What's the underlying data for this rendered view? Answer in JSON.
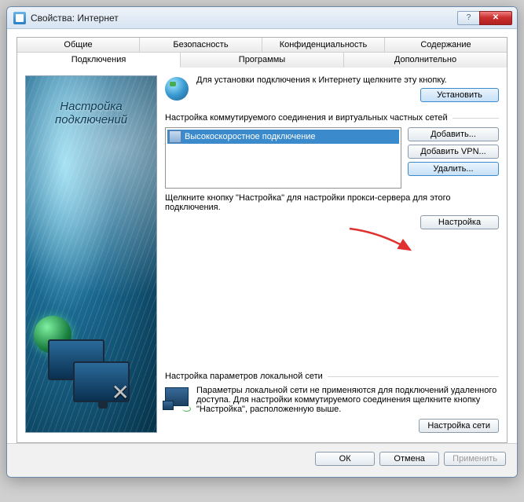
{
  "titlebar": {
    "title": "Свойства: Интернет"
  },
  "tabs": {
    "row1": [
      "Общие",
      "Безопасность",
      "Конфиденциальность",
      "Содержание"
    ],
    "row2": [
      "Подключения",
      "Программы",
      "Дополнительно"
    ],
    "active": "Подключения"
  },
  "side": {
    "line1": "Настройка",
    "line2": "подключений"
  },
  "setup": {
    "text": "Для установки подключения к Интернету щелкните эту кнопку.",
    "button": "Установить"
  },
  "dial": {
    "label": "Настройка коммутируемого соединения и виртуальных частных сетей",
    "item": "Высокоскоростное подключение",
    "add": "Добавить...",
    "addvpn": "Добавить VPN...",
    "remove": "Удалить...",
    "note": "Щелкните кнопку \"Настройка\" для настройки прокси-сервера для этого подключения.",
    "settings": "Настройка"
  },
  "lan": {
    "label": "Настройка параметров локальной сети",
    "text": "Параметры локальной сети не применяются для подключений удаленного доступа. Для настройки коммутируемого соединения щелкните кнопку \"Настройка\", расположенную выше.",
    "button": "Настройка сети"
  },
  "footer": {
    "ok": "ОК",
    "cancel": "Отмена",
    "apply": "Применить"
  }
}
